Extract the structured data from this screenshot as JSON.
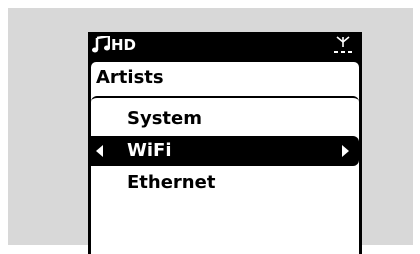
{
  "status_bar": {
    "source_label": "HD",
    "source_icon": "music-note-icon",
    "signal_icon": "antenna-signal-icon"
  },
  "menu": {
    "folder_title": "Artists",
    "items": [
      {
        "label": "System",
        "selected": false
      },
      {
        "label": "WiFi",
        "selected": true
      },
      {
        "label": "Ethernet",
        "selected": false
      }
    ]
  },
  "colors": {
    "screen_background": "#000000",
    "content_background": "#ffffff",
    "highlight": "#000000",
    "panel_background": "#d8d8d8"
  }
}
